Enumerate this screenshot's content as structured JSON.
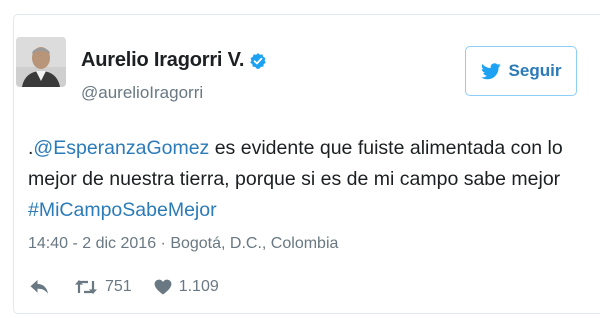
{
  "author": {
    "display_name": "Aurelio Iragorri V.",
    "handle": "@aurelioIragorri",
    "verified": true
  },
  "follow_button": {
    "label": "Seguir",
    "icon": "bird-icon",
    "color": "#2b7bb9"
  },
  "tweet": {
    "mention": "@EsperanzaGomez",
    "line1_prefix": ".",
    "line1_rest": " es evidente que fuiste alimentada con lo",
    "line2": "mejor de nuestra tierra, porque si es de mi campo sabe mejor",
    "hashtag": "#MiCampoSabeMejor"
  },
  "meta": {
    "timestamp": "14:40 - 2 dic 2016",
    "separator": " · ",
    "location": "Bogotá, D.C., Colombia"
  },
  "actions": {
    "reply_icon": "reply-icon",
    "retweet_icon": "retweet-icon",
    "retweet_count": "751",
    "like_icon": "heart-icon",
    "like_count": "1.109"
  },
  "colors": {
    "link": "#2b7bb9",
    "secondary_text": "#697882",
    "verified": "#1da1f2"
  }
}
